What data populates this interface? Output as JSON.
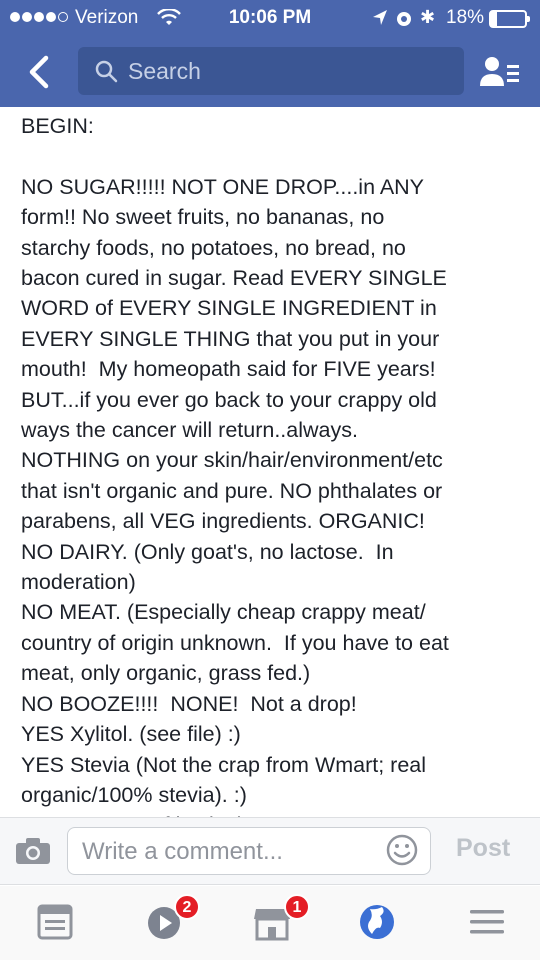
{
  "status_bar": {
    "carrier": "Verizon",
    "time": "10:06 PM",
    "battery_percent": "18%",
    "battery_level": 0.18
  },
  "nav": {
    "search_placeholder": "Search",
    "back_icon": "chevron-left-icon",
    "friends_icon": "friends-list-icon"
  },
  "post": {
    "text_lines": [
      "BEGIN:",
      "",
      "NO SUGAR!!!!! NOT ONE DROP....in ANY",
      "form!! No sweet fruits, no bananas, no",
      "starchy foods, no potatoes, no bread, no",
      "bacon cured in sugar. Read EVERY SINGLE",
      "WORD of EVERY SINGLE INGREDIENT in",
      "EVERY SINGLE THING that you put in your",
      "mouth!  My homeopath said for FIVE years!",
      "BUT...if you ever go back to your crappy old",
      "ways the cancer will return..always.",
      "NOTHING on your skin/hair/environment/etc",
      "that isn't organic and pure. NO phthalates or",
      "parabens, all VEG ingredients. ORGANIC!",
      "NO DAIRY. (Only goat's, no lactose.  In",
      "moderation)",
      "NO MEAT. (Especially cheap crappy meat/",
      "country of origin unknown.  If you have to eat",
      "meat, only organic, grass fed.)",
      "NO BOOZE!!!!  NONE!  Not a drop!",
      "YES Xylitol. (see file) :)",
      "YES Stevia (Not the crap from Wmart; real",
      "organic/100% stevia). :)",
      "Yes Sweet Leaf is ok. :)"
    ]
  },
  "comment_bar": {
    "placeholder": "Write a comment...",
    "post_label": "Post"
  },
  "tab_bar": {
    "tabs": [
      {
        "name": "news-feed",
        "icon": "news-feed-icon",
        "badge": ""
      },
      {
        "name": "video",
        "icon": "video-play-icon",
        "badge": "2"
      },
      {
        "name": "marketplace",
        "icon": "marketplace-icon",
        "badge": "1"
      },
      {
        "name": "notifications",
        "icon": "globe-icon",
        "badge": ""
      },
      {
        "name": "more",
        "icon": "menu-icon",
        "badge": ""
      }
    ]
  },
  "colors": {
    "brand_blue": "#4a66ad",
    "search_blue": "#3b5694",
    "badge_red": "#e41e26",
    "text_dark": "#1d2129"
  }
}
